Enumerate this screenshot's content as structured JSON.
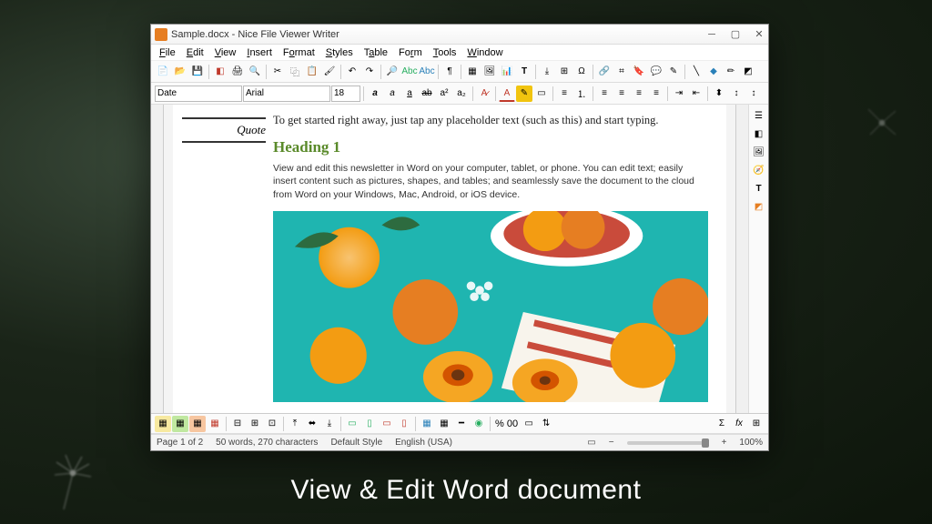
{
  "window": {
    "title": "Sample.docx - Nice File Viewer Writer"
  },
  "menu": [
    "File",
    "Edit",
    "View",
    "Insert",
    "Format",
    "Styles",
    "Table",
    "Form",
    "Tools",
    "Window"
  ],
  "formatbar": {
    "style": "Date",
    "font": "Arial",
    "size": "18"
  },
  "document": {
    "quote_label": "Quote",
    "intro": "To get started right away, just tap any placeholder text (such as this) and start typing.",
    "heading1": "Heading 1",
    "body": "View and edit this newsletter in Word on your computer, tablet, or phone. You can edit text; easily insert content such as pictures, shapes, and tables; and seamlessly save the document to the cloud from Word on your Windows, Mac, Android, or iOS device."
  },
  "toolbar2": {
    "percent": "% 00"
  },
  "status": {
    "page": "Page 1 of 2",
    "words": "50 words, 270 characters",
    "style": "Default Style",
    "lang": "English (USA)",
    "zoom": "100%"
  },
  "caption": "View & Edit Word document",
  "colors": {
    "heading": "#5a8a2a",
    "accent_orange": "#e67e22"
  }
}
